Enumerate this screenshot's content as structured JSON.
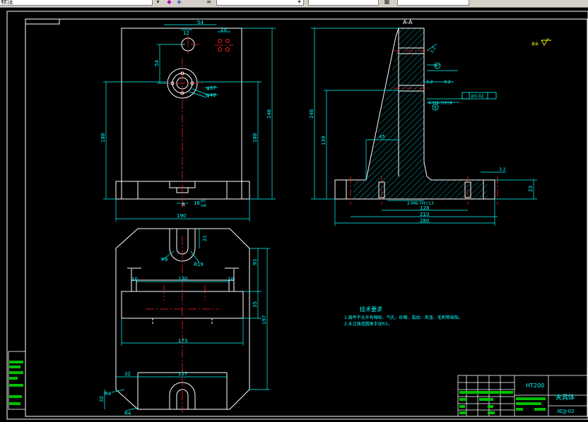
{
  "toolbar": {
    "layer_value": "标注",
    "linetype_value": "",
    "lineweight_value": "",
    "plotstyle_value": ""
  },
  "colors": {
    "background": "#000000",
    "outline": "#ffffff",
    "dimension": "#00ffff",
    "centerline": "#ff2020",
    "hatch": "#00e0e0",
    "symbol": "#ffff00",
    "titleblock_fill": "#00c000"
  },
  "section_label": "A-A",
  "roughness_note": "其余",
  "front_view": {
    "dims": {
      "top_width": "54",
      "hole_offset": "12",
      "pin_spacing": "20",
      "hole_height": "54",
      "hole_a": "φ37",
      "hole_b": "φ48",
      "total_height": "246",
      "left_height": "188",
      "right_height": "188",
      "bottom_a": "16",
      "bottom_b": "H7",
      "bottom_c": "m6",
      "width": "190",
      "section_mark": "A"
    }
  },
  "side_view": {
    "dims": {
      "total_height": "246",
      "web_height": "139",
      "web_offset": "45",
      "rough_a": "3.2",
      "rough_b": "3.2",
      "rough_c": "3.2",
      "thread_note": "4-M4-7H▽9",
      "thread_note_2": "2-M6-7H▽13",
      "tolerance": "⊘0.02",
      "datum_a": "A",
      "datum_b": "B",
      "w1": "128",
      "w2": "210",
      "w3": "280",
      "base_height": "23",
      "base_rough": "3.2"
    }
  },
  "top_view": {
    "dims": {
      "slot_depth": "21",
      "r_slot": "R9",
      "r_slot_2": "R19",
      "left_flange": "10",
      "right_flange": "10",
      "inner_width": "130",
      "base_width": "173",
      "right_a": "93",
      "right_b": "35",
      "total_h": "197",
      "bottom_w": "127",
      "chamfer_w": "32",
      "chamfer_h": "32",
      "r_corner": "R4",
      "r_corner_2": "R4"
    }
  },
  "notes": {
    "title": "技术要求",
    "line1": "1.铸件不允许有缩松、气孔、砂眼、裂纹、夹渣、毛刺等缺陷。",
    "line2": "2.未注铸造圆角半径R3。"
  },
  "title_block": {
    "material": "HT200",
    "part_name": "夹具体",
    "drawing_no": "XCJJ-02"
  }
}
